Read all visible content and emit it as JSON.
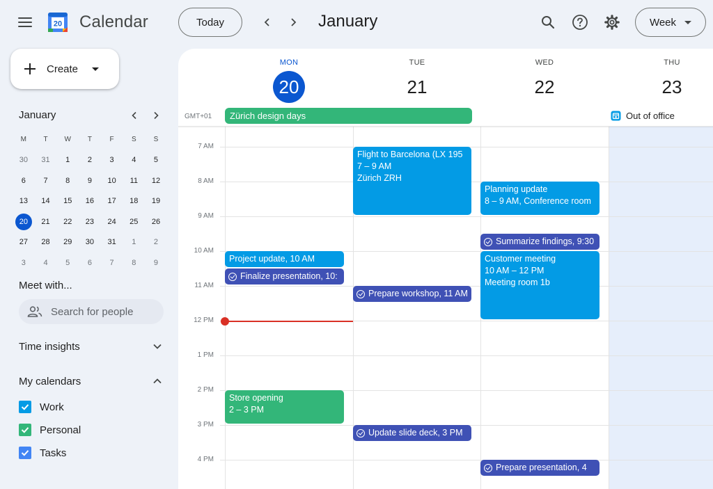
{
  "header": {
    "app_title": "Calendar",
    "logo_day": "20",
    "today_label": "Today",
    "month": "January",
    "view_label": "Week"
  },
  "sidebar": {
    "create_label": "Create",
    "mini_calendar": {
      "month": "January",
      "dow": [
        "M",
        "T",
        "W",
        "T",
        "F",
        "S",
        "S"
      ],
      "weeks": [
        [
          "30",
          "31",
          "1",
          "2",
          "3",
          "4",
          "5"
        ],
        [
          "6",
          "7",
          "8",
          "9",
          "10",
          "11",
          "12"
        ],
        [
          "13",
          "14",
          "15",
          "16",
          "17",
          "18",
          "19"
        ],
        [
          "20",
          "21",
          "22",
          "23",
          "24",
          "25",
          "26"
        ],
        [
          "27",
          "28",
          "29",
          "30",
          "31",
          "1",
          "2"
        ],
        [
          "3",
          "4",
          "5",
          "6",
          "7",
          "8",
          "9"
        ]
      ],
      "selected": "20"
    },
    "meet_title": "Meet with...",
    "search_placeholder": "Search for people",
    "time_insights": "Time insights",
    "my_calendars": "My calendars",
    "calendars": [
      {
        "label": "Work",
        "color": "#039be5"
      },
      {
        "label": "Personal",
        "color": "#33b679"
      },
      {
        "label": "Tasks",
        "color": "#4285f4"
      }
    ]
  },
  "week": {
    "timezone": "GMT+01",
    "days": [
      {
        "dow": "MON",
        "num": "20"
      },
      {
        "dow": "TUE",
        "num": "21"
      },
      {
        "dow": "WED",
        "num": "22"
      },
      {
        "dow": "THU",
        "num": "23"
      }
    ],
    "hours": [
      "7 AM",
      "8 AM",
      "9 AM",
      "10 AM",
      "11 AM",
      "12 PM",
      "1 PM",
      "2 PM",
      "3 PM",
      "4 PM"
    ],
    "all_day_event": "Zürich design days",
    "out_of_office": "Out of office"
  },
  "events": {
    "flight": {
      "title": "Flight to Barcelona (LX 195",
      "time": "7 – 9 AM",
      "place": "Zürich ZRH"
    },
    "planning": {
      "title": "Planning update",
      "time": "8 – 9 AM, Conference room"
    },
    "summarize": {
      "title": "Summarize findings, 9:30"
    },
    "project": {
      "title": "Project update, 10 AM"
    },
    "finalize": {
      "title": "Finalize presentation, 10:"
    },
    "customer": {
      "title": "Customer meeting",
      "time": "10 AM – 12 PM",
      "place": "Meeting room 1b"
    },
    "workshop": {
      "title": "Prepare workshop, 11 AM"
    },
    "store": {
      "title": "Store opening",
      "time": "2 – 3 PM"
    },
    "slide": {
      "title": "Update slide deck, 3 PM"
    },
    "prep_pres": {
      "title": "Prepare presentation, 4"
    }
  },
  "colors": {
    "accent": "#0b57d0",
    "event_blue": "#039be5",
    "event_green": "#33b679",
    "task_indigo": "#3f51b5",
    "now_red": "#d93025"
  }
}
